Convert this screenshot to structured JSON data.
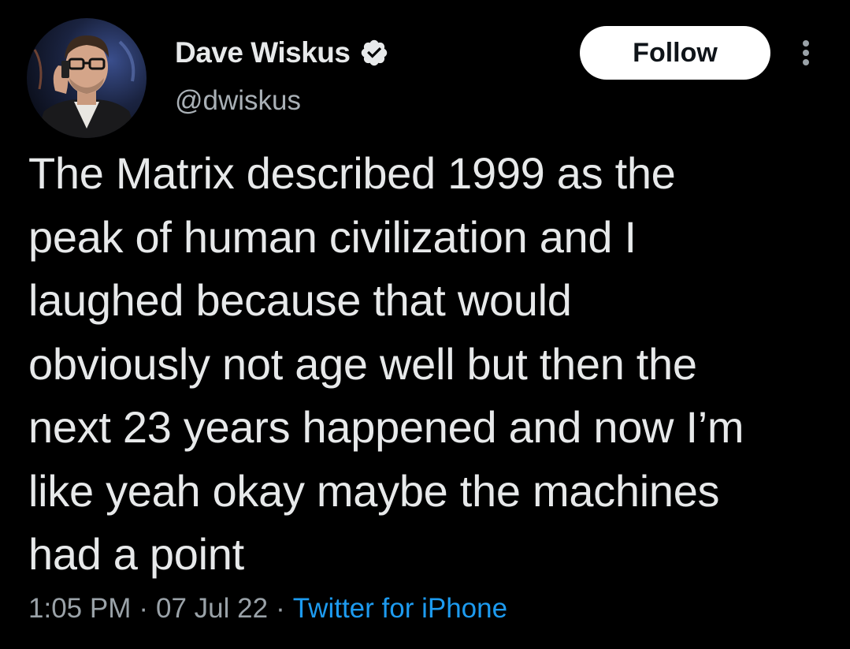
{
  "author": {
    "display_name": "Dave Wiskus",
    "handle": "@dwiskus",
    "verified": true,
    "avatar_icon": "profile-photo-man-with-glasses-on-phone"
  },
  "actions": {
    "follow_label": "Follow",
    "more_icon": "vertical-ellipsis-icon"
  },
  "tweet": {
    "lines": [
      "The Matrix described 1999 as the",
      "peak of human civilization and I",
      "laughed because that would",
      "obviously not age well but then the",
      "next 23 years happened and now I’m",
      "like yeah okay maybe the machines",
      "had a point"
    ]
  },
  "meta": {
    "time": "1:05 PM",
    "separator": "·",
    "date": "07 Jul 22",
    "source": "Twitter for iPhone"
  },
  "colors": {
    "background": "#000000",
    "text": "#e7e9ea",
    "secondary": "#9aa2a8",
    "link": "#1d9bf0",
    "follow_bg": "#ffffff"
  }
}
